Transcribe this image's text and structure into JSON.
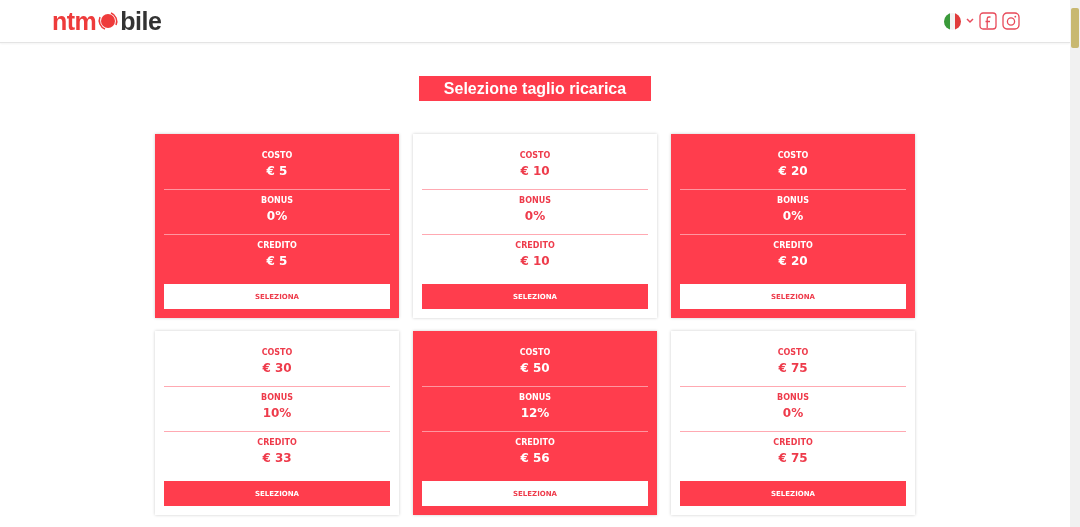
{
  "header": {
    "logo_left": "ntm",
    "logo_right": "bile"
  },
  "title": "Selezione taglio ricarica",
  "cards": [
    {
      "highlighted": true,
      "rows": [
        {
          "label": "COSTO",
          "value": "€ 5"
        },
        {
          "label": "BONUS",
          "value": "0%"
        },
        {
          "label": "CREDITO",
          "value": "€ 5"
        }
      ],
      "button": "SELEZIONA"
    },
    {
      "highlighted": false,
      "rows": [
        {
          "label": "COSTO",
          "value": "€ 10"
        },
        {
          "label": "BONUS",
          "value": "0%"
        },
        {
          "label": "CREDITO",
          "value": "€ 10"
        }
      ],
      "button": "SELEZIONA"
    },
    {
      "highlighted": true,
      "rows": [
        {
          "label": "COSTO",
          "value": "€ 20"
        },
        {
          "label": "BONUS",
          "value": "0%"
        },
        {
          "label": "CREDITO",
          "value": "€ 20"
        }
      ],
      "button": "SELEZIONA"
    },
    {
      "highlighted": false,
      "rows": [
        {
          "label": "COSTO",
          "value": "€ 30"
        },
        {
          "label": "BONUS",
          "value": "10%"
        },
        {
          "label": "CREDITO",
          "value": "€ 33"
        }
      ],
      "button": "SELEZIONA"
    },
    {
      "highlighted": true,
      "rows": [
        {
          "label": "COSTO",
          "value": "€ 50"
        },
        {
          "label": "BONUS",
          "value": "12%"
        },
        {
          "label": "CREDITO",
          "value": "€ 56"
        }
      ],
      "button": "SELEZIONA"
    },
    {
      "highlighted": false,
      "rows": [
        {
          "label": "COSTO",
          "value": "€ 75"
        },
        {
          "label": "BONUS",
          "value": "0%"
        },
        {
          "label": "CREDITO",
          "value": "€ 75"
        }
      ],
      "button": "SELEZIONA"
    }
  ]
}
